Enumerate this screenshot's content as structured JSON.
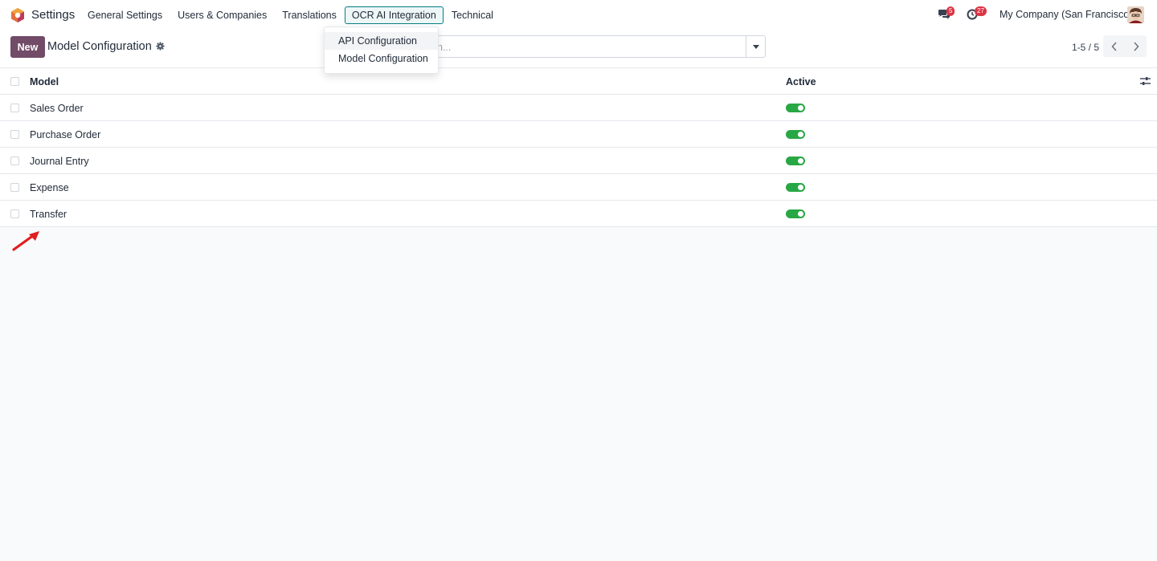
{
  "app": {
    "name": "Settings"
  },
  "menu": {
    "items": [
      "General Settings",
      "Users & Companies",
      "Translations",
      "OCR AI Integration",
      "Technical"
    ]
  },
  "dropdown": {
    "items": [
      "API Configuration",
      "Model Configuration"
    ]
  },
  "systray": {
    "chat_count": "5",
    "activity_count": "27",
    "company": "My Company (San Francisco)"
  },
  "control_panel": {
    "new_label": "New",
    "title": "Model Configuration",
    "search_placeholder": "h...",
    "pager": "1-5 / 5"
  },
  "list": {
    "headers": {
      "model": "Model",
      "active": "Active"
    },
    "rows": [
      {
        "model": "Sales Order",
        "active": true
      },
      {
        "model": "Purchase Order",
        "active": true
      },
      {
        "model": "Journal Entry",
        "active": true
      },
      {
        "model": "Expense",
        "active": true
      },
      {
        "model": "Transfer",
        "active": true
      }
    ]
  },
  "colors": {
    "primary": "#714b67",
    "toggle_on": "#28a745",
    "active_menu_border": "#017e84",
    "badge": "#dc3545",
    "annotation_arrow": "#e11d1d"
  }
}
